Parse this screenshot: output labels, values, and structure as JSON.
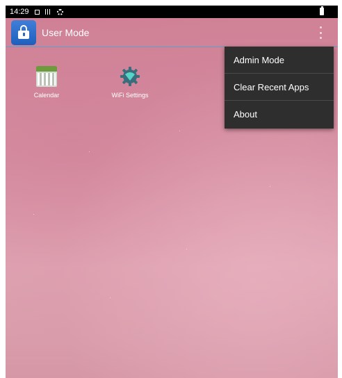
{
  "status_bar": {
    "time": "14:29",
    "icons": [
      "square-notification-icon",
      "grid-notification-icon",
      "settings-notification-icon",
      "battery-icon"
    ]
  },
  "app_bar": {
    "title": "User Mode",
    "logo_icon": "lock-icon",
    "overflow_icon": "overflow-menu-icon"
  },
  "launcher": {
    "apps": [
      {
        "label": "Calendar",
        "icon": "calendar-icon"
      },
      {
        "label": "WiFi Settings",
        "icon": "wifi-settings-icon"
      }
    ]
  },
  "overflow_menu": {
    "items": [
      {
        "label": "Admin Mode"
      },
      {
        "label": "Clear Recent Apps"
      },
      {
        "label": "About"
      }
    ]
  },
  "colors": {
    "status_bar_bg": "#000000",
    "app_bar_divider": "#5aa1c7",
    "menu_bg": "#2e2e2e",
    "logo_blue": "#2a64c0",
    "wallpaper_pink": "#d68fa2"
  }
}
